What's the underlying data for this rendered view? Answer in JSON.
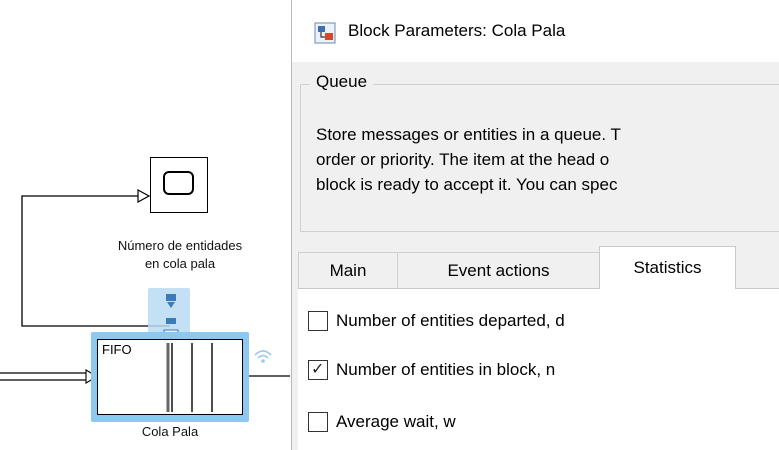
{
  "canvas": {
    "scope_label_line1": "Número de entidades",
    "scope_label_line2": "en cola pala",
    "queue_block_text": "FIFO",
    "queue_block_label": "Cola Pala"
  },
  "dialog": {
    "title": "Block Parameters: Cola Pala",
    "group_title": "Queue",
    "description_lines": [
      "Store messages or entities in a queue. T",
      "order or priority. The item at the head o",
      "block is ready to accept it. You can spec"
    ],
    "tabs": [
      {
        "label": "Main",
        "active": false
      },
      {
        "label": "Event actions",
        "active": false
      },
      {
        "label": "Statistics",
        "active": true
      }
    ],
    "statistics": [
      {
        "label": "Number of entities departed, d",
        "checked": false
      },
      {
        "label": "Number of entities in block, n",
        "checked": true
      },
      {
        "label": "Average wait, w",
        "checked": false
      }
    ]
  },
  "colors": {
    "selection_highlight": "#8cc8f0",
    "dialog_background": "#f0f0f0",
    "tab_active": "#ffffff"
  },
  "icons": {
    "title_icon": "simulink-block-icon",
    "scope_icon": "scope-display-icon",
    "wireless_icon": "signal-wave-icon"
  }
}
